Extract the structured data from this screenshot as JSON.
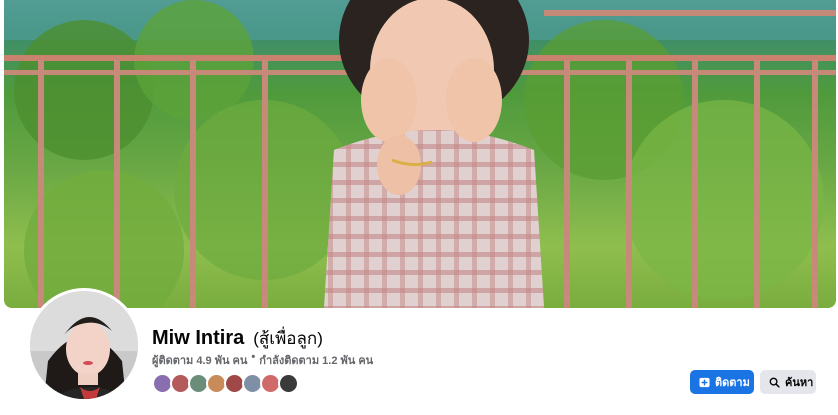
{
  "profile": {
    "name": "Miw Intira",
    "alt_name": "(สู้เพื่อลูก)",
    "followers_text": "ผู้ติดตาม 4.9 พัน คน",
    "separator": "•",
    "following_text": "กำลังติดตาม 1.2 พัน คน"
  },
  "friends": {
    "count_shown": 8,
    "colors": [
      "#8a6fb0",
      "#b45a5a",
      "#6b8e7a",
      "#c98b5a",
      "#a04848",
      "#7f8fa6",
      "#d06a6a",
      "#3a3a3a"
    ]
  },
  "actions": {
    "follow_label": "ติดตาม",
    "search_label": "ค้นหา"
  },
  "icons": {
    "follow": "follow-plus-icon",
    "search": "search-icon"
  },
  "colors": {
    "primary_button": "#1b74e4",
    "secondary_button": "#e4e6eb",
    "secondary_text": "#65676b"
  }
}
